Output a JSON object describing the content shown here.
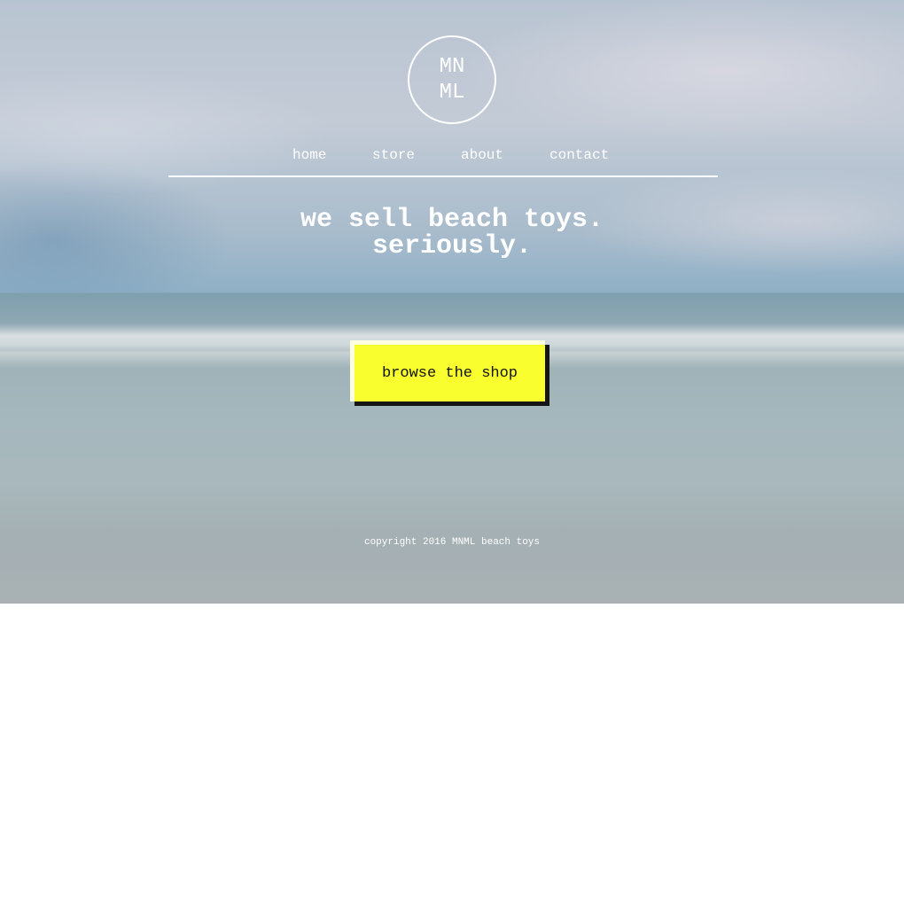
{
  "logo": {
    "line1": "MN",
    "line2": "ML"
  },
  "nav": {
    "items": [
      {
        "label": "home"
      },
      {
        "label": "store"
      },
      {
        "label": "about"
      },
      {
        "label": "contact"
      }
    ]
  },
  "hero": {
    "line1": "we sell beach toys.",
    "line2": "seriously."
  },
  "cta": {
    "label": "browse the shop",
    "color": "#f9ff2e"
  },
  "footer": {
    "copyright": "copyright 2016 MNML beach toys"
  }
}
